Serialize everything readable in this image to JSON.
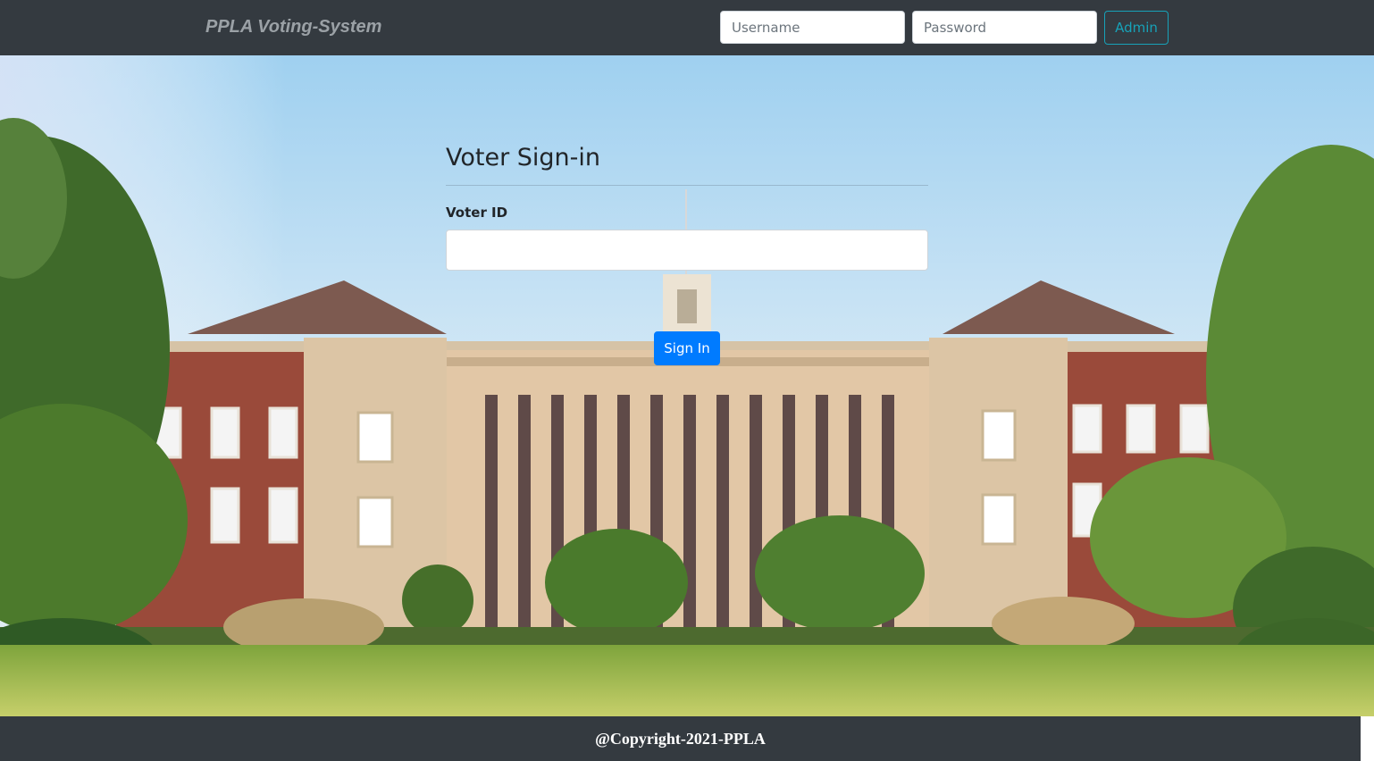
{
  "navbar": {
    "brand": "PPLA Voting-System",
    "username_placeholder": "Username",
    "password_placeholder": "Password",
    "admin_label": "Admin"
  },
  "signin": {
    "title": "Voter Sign-in",
    "voter_id_label": "Voter ID",
    "voter_id_value": "",
    "submit_label": "Sign In"
  },
  "footer": {
    "text": "@Copyright-2021-PPLA"
  },
  "colors": {
    "navbar_bg": "#343a40",
    "primary": "#007bff",
    "info": "#17a2b8"
  }
}
